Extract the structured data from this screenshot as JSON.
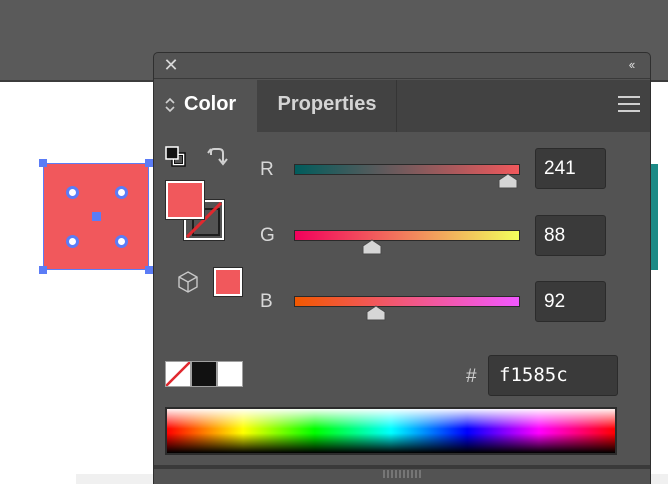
{
  "panel": {
    "close_glyph": "✕",
    "collapse_glyph": "‹‹",
    "tabs": [
      {
        "label": "Color",
        "active": true
      },
      {
        "label": "Properties",
        "active": false
      }
    ]
  },
  "color": {
    "fill_hex": "#f1585c",
    "channels": [
      {
        "label": "R",
        "value": "241",
        "level": 0.945
      },
      {
        "label": "G",
        "value": "88",
        "level": 0.345
      },
      {
        "label": "B",
        "value": "92",
        "level": 0.361
      }
    ],
    "hex_symbol": "#",
    "hex_value": "f1585c"
  },
  "icons": {
    "close": "close-icon",
    "collapse": "double-chevron-left-icon",
    "menu": "hamburger-menu-icon",
    "default_colors": "default-fill-stroke-icon",
    "swap": "swap-arrow-icon",
    "out_of_gamut": "cube-icon"
  },
  "colors": {
    "panel_bg": "#535353",
    "tab_bg": "#424242",
    "field_bg": "#3a3a3a",
    "selection": "#5b7cf6",
    "fill": "#f1585c"
  }
}
